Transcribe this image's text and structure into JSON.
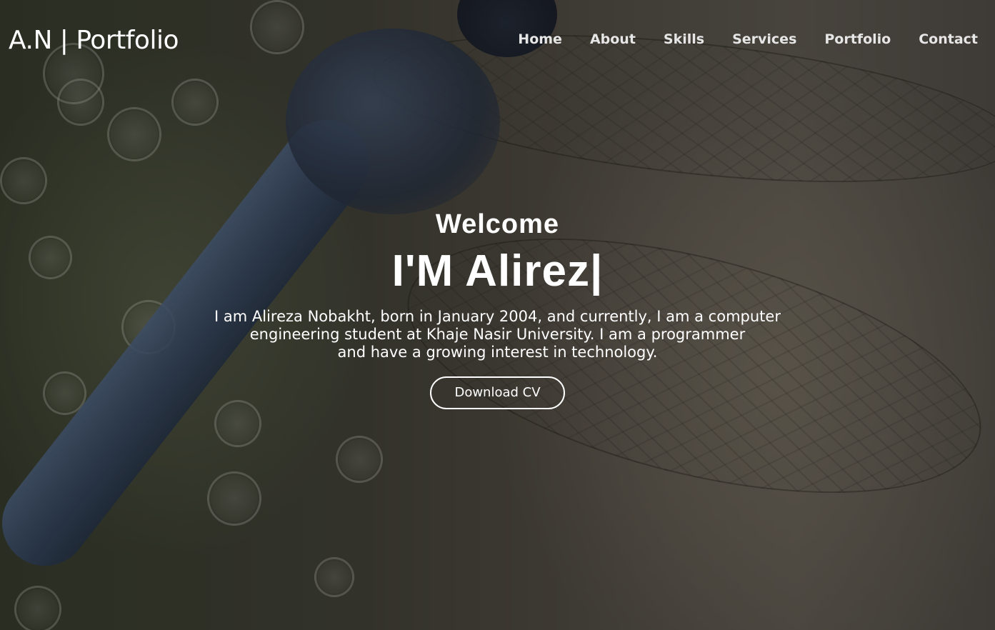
{
  "header": {
    "logo": "A.N | Portfolio",
    "nav": [
      {
        "label": "Home"
      },
      {
        "label": "About"
      },
      {
        "label": "Skills"
      },
      {
        "label": "Services"
      },
      {
        "label": "Portfolio"
      },
      {
        "label": "Contact"
      }
    ]
  },
  "hero": {
    "welcome": "Welcome",
    "typing_text": "I'M Alirez|",
    "bio_lines": [
      "I am Alireza Nobakht, born in January 2004, and currently, I am a computer",
      "engineering student at Khaje Nasir University. I am a programmer",
      "and have a growing interest in technology."
    ],
    "cta_label": "Download CV"
  },
  "colors": {
    "text": "#ffffff",
    "nav_text": "#e6e6e6",
    "overlay": "rgba(0,0,0,0.32)"
  }
}
